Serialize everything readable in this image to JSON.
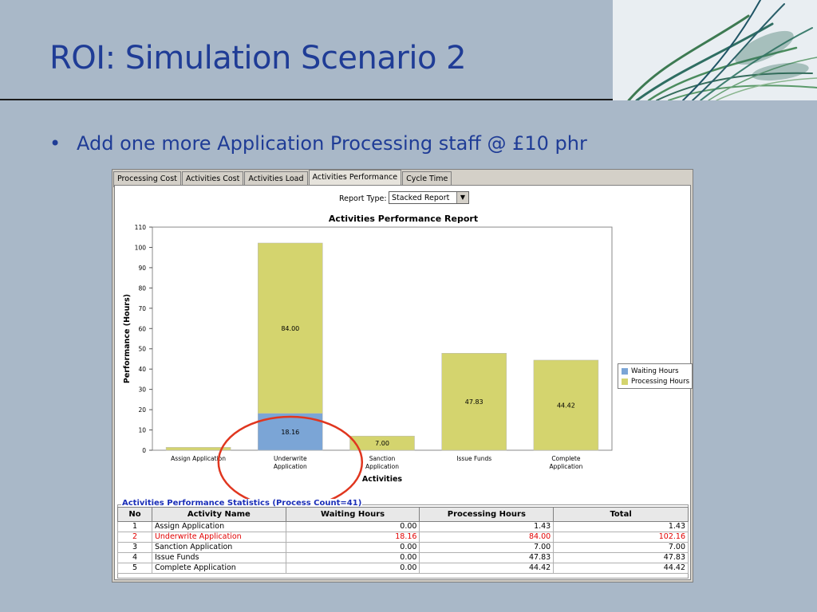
{
  "slide": {
    "title": "ROI: Simulation Scenario 2",
    "bullet_symbol": "•",
    "bullet": "Add one more Application Processing staff @ £10 phr"
  },
  "tabs": [
    {
      "label": "Processing Cost",
      "active": false
    },
    {
      "label": "Activities Cost",
      "active": false
    },
    {
      "label": "Activities Load",
      "active": false
    },
    {
      "label": "Activities Performance",
      "active": true
    },
    {
      "label": "Cycle Time",
      "active": false
    }
  ],
  "report": {
    "type_label": "Report Type:",
    "type_value": "Stacked Report",
    "arrow": "▼"
  },
  "chart_data": {
    "type": "bar",
    "stacked": true,
    "title": "Activities Performance Report",
    "xlabel": "Activities",
    "ylabel": "Performance (Hours)",
    "ylim": [
      0,
      110
    ],
    "yticks": [
      0,
      10,
      20,
      30,
      40,
      50,
      60,
      70,
      80,
      90,
      100,
      110
    ],
    "categories": [
      "Assign Application",
      "Underwrite Application",
      "Sanction Application",
      "Issue Funds",
      "Complete Application"
    ],
    "category_lines": [
      [
        "Assign Application"
      ],
      [
        "Underwrite",
        "Application"
      ],
      [
        "Sanction",
        "Application"
      ],
      [
        "Issue Funds"
      ],
      [
        "Complete",
        "Application"
      ]
    ],
    "series": [
      {
        "name": "Waiting Hours",
        "color": "#7ba5d6",
        "values": [
          0.0,
          18.16,
          0.0,
          0.0,
          0.0
        ]
      },
      {
        "name": "Processing Hours",
        "color": "#d4d46e",
        "values": [
          1.43,
          84.0,
          7.0,
          47.83,
          44.42
        ]
      }
    ],
    "data_labels": [
      {
        "category": 1,
        "series": 0,
        "text": "18.16"
      },
      {
        "category": 1,
        "series": 1,
        "text": "84.00"
      },
      {
        "category": 2,
        "series": 1,
        "text": "7.00"
      },
      {
        "category": 3,
        "series": 1,
        "text": "47.83"
      },
      {
        "category": 4,
        "series": 1,
        "text": "44.42"
      }
    ],
    "legend_position": "right",
    "grid": false,
    "highlight": {
      "category": 1,
      "shape": "ellipse",
      "color": "#e0361f"
    }
  },
  "stats": {
    "title": "Activities Performance Statistics (Process Count=41)",
    "columns": [
      "No",
      "Activity Name",
      "Waiting Hours",
      "Processing Hours",
      "Total"
    ],
    "rows": [
      {
        "no": "1",
        "name": "Assign Application",
        "waiting": "0.00",
        "processing": "1.43",
        "total": "1.43",
        "highlight": false
      },
      {
        "no": "2",
        "name": "Underwrite Application",
        "waiting": "18.16",
        "processing": "84.00",
        "total": "102.16",
        "highlight": true
      },
      {
        "no": "3",
        "name": "Sanction Application",
        "waiting": "0.00",
        "processing": "7.00",
        "total": "7.00",
        "highlight": false
      },
      {
        "no": "4",
        "name": "Issue Funds",
        "waiting": "0.00",
        "processing": "47.83",
        "total": "47.83",
        "highlight": false
      },
      {
        "no": "5",
        "name": "Complete Application",
        "waiting": "0.00",
        "processing": "44.42",
        "total": "44.42",
        "highlight": false
      }
    ]
  },
  "colors": {
    "title": "#1f3c96",
    "waiting": "#7ba5d6",
    "processing": "#d4d46e",
    "highlight_text": "#e10000",
    "circle": "#e0361f"
  }
}
